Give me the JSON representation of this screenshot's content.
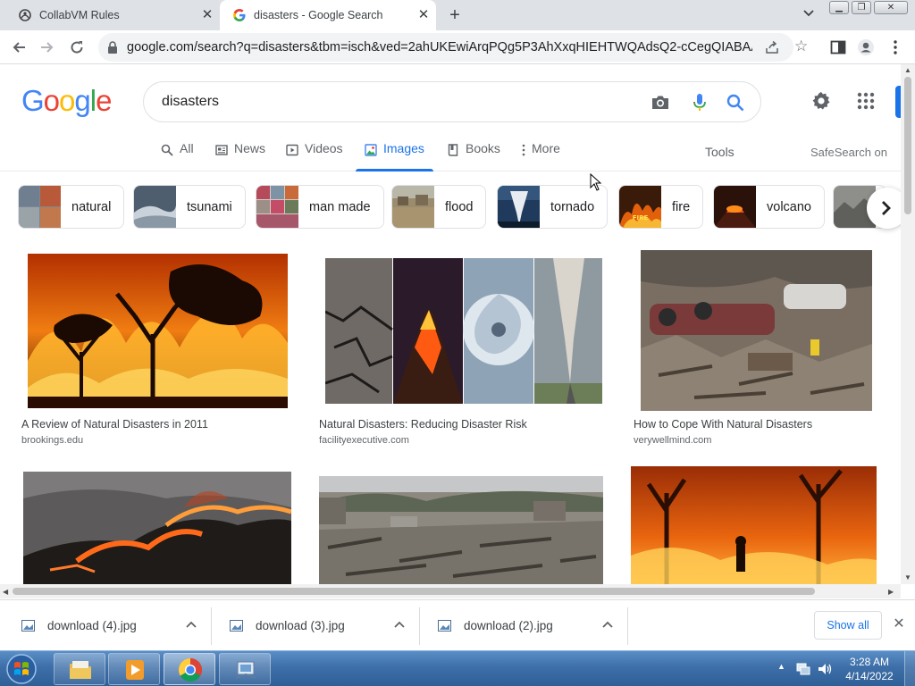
{
  "browser": {
    "tabs": [
      {
        "title": "CollabVM Rules",
        "icon": "collabvm-icon",
        "active": false
      },
      {
        "title": "disasters - Google Search",
        "icon": "google-icon",
        "active": true
      }
    ],
    "new_tab_icon": "plus-icon",
    "url": "google.com/search?q=disasters&tbm=isch&ved=2ahUKEwiArqPQg5P3AhXxqHIEHTWQAdsQ2-cCegQIABAA&o..."
  },
  "google": {
    "logo_letters": [
      {
        "ch": "G",
        "color": "#4285F4"
      },
      {
        "ch": "o",
        "color": "#EA4335"
      },
      {
        "ch": "o",
        "color": "#FBBC05"
      },
      {
        "ch": "g",
        "color": "#4285F4"
      },
      {
        "ch": "l",
        "color": "#34A853"
      },
      {
        "ch": "e",
        "color": "#EA4335"
      }
    ],
    "query": "disasters",
    "nav_tabs": [
      {
        "label": "All",
        "icon": "search-icon"
      },
      {
        "label": "News",
        "icon": "news-icon"
      },
      {
        "label": "Videos",
        "icon": "video-icon"
      },
      {
        "label": "Images",
        "icon": "image-icon",
        "active": true
      },
      {
        "label": "Books",
        "icon": "book-icon"
      },
      {
        "label": "More",
        "icon": "more-vert-icon"
      }
    ],
    "tools": "Tools",
    "safesearch": "SafeSearch on",
    "chips": [
      "natural",
      "tsunami",
      "man made",
      "flood",
      "tornado",
      "fire",
      "volcano"
    ],
    "results": [
      {
        "caption": "A Review of Natural Disasters in 2011",
        "source": "brookings.edu",
        "image": "forest-fire-photo"
      },
      {
        "caption": "Natural Disasters: Reducing Disaster Risk",
        "source": "facilityexecutive.com",
        "image": "disaster-collage-photo"
      },
      {
        "caption": "How to Cope With Natural Disasters",
        "source": "verywellmind.com",
        "image": "tsunami-debris-photo"
      },
      {
        "caption": "",
        "source": "",
        "image": "hillside-fire-photo"
      },
      {
        "caption": "",
        "source": "",
        "image": "destroyed-town-photo"
      },
      {
        "caption": "",
        "source": "",
        "image": "firefighter-fire-photo"
      }
    ]
  },
  "downloads": {
    "items": [
      "download (4).jpg",
      "download (3).jpg",
      "download (2).jpg"
    ],
    "show_all": "Show all"
  },
  "taskbar": {
    "time": "3:28 AM",
    "date": "4/14/2022"
  }
}
